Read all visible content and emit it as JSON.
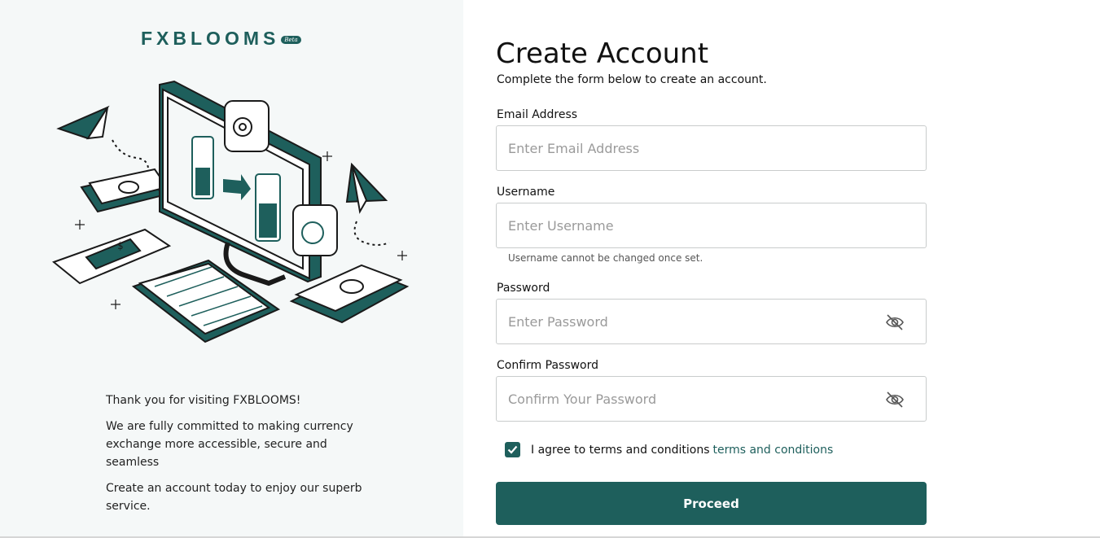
{
  "brand": {
    "name": "FXBLOOMS",
    "badge": "Beta",
    "accent": "#1e5f5c"
  },
  "illustration": {
    "icon": "money-transfer-illustration"
  },
  "welcome": {
    "line1": "Thank you for visiting FXBLOOMS!",
    "line2": "We are fully committed to making currency exchange more accessible, secure and seamless",
    "line3": "Create an account today to enjoy our superb service."
  },
  "form": {
    "title": "Create Account",
    "subtitle": "Complete the form below to create an account.",
    "email": {
      "label": "Email Address",
      "placeholder": "Enter Email Address",
      "value": ""
    },
    "username": {
      "label": "Username",
      "placeholder": "Enter Username",
      "value": "",
      "hint": "Username cannot be changed once set."
    },
    "password": {
      "label": "Password",
      "placeholder": "Enter Password",
      "value": "",
      "icon": "eye-off-icon"
    },
    "confirm": {
      "label": "Confirm Password",
      "placeholder": "Confirm Your Password",
      "value": "",
      "icon": "eye-off-icon"
    },
    "terms": {
      "checked": true,
      "text": "I agree to terms and conditions",
      "link": "terms and conditions"
    },
    "submit": "Proceed"
  }
}
